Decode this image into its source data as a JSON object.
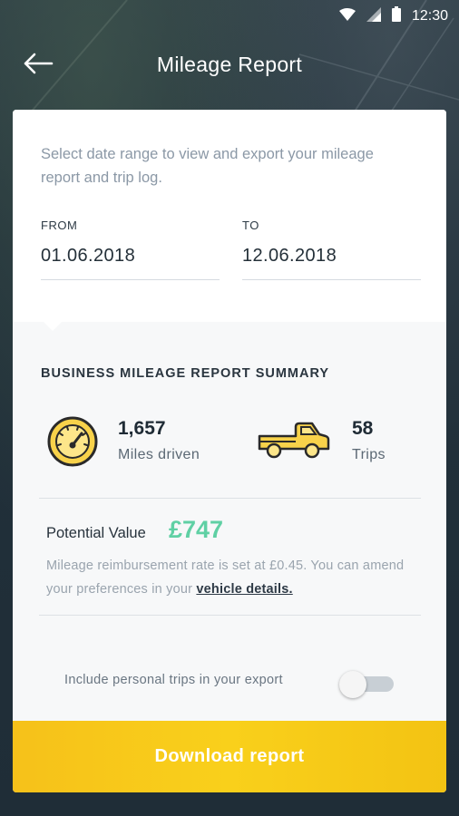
{
  "status_bar": {
    "time": "12:30",
    "icons": [
      "wifi-icon",
      "signal-icon",
      "battery-icon"
    ]
  },
  "app_bar": {
    "title": "Mileage Report",
    "back_icon": "arrow-left-icon"
  },
  "intro_text": "Select date range to view and export your mileage report and trip log.",
  "date_range": {
    "from_label": "FROM",
    "from_value": "01.06.2018",
    "to_label": "TO",
    "to_value": "12.06.2018"
  },
  "summary": {
    "title": "BUSINESS MILEAGE REPORT SUMMARY",
    "miles": {
      "value": "1,657",
      "label": "Miles driven",
      "icon": "speedometer-icon"
    },
    "trips": {
      "value": "58",
      "label": "Trips",
      "icon": "pickup-truck-icon"
    }
  },
  "potential_value": {
    "label": "Potential Value",
    "amount": "£747"
  },
  "reimbursement": {
    "text": "Mileage reimbursement rate is set at £0.45. You can amend your preferences in your ",
    "link": "vehicle details."
  },
  "personal_trips": {
    "label": "Include personal trips in your export",
    "enabled": false
  },
  "download_button": "Download report",
  "colors": {
    "accent_yellow": "#f9d01b",
    "value_green": "#5fd0a4",
    "background": "#23323d"
  }
}
